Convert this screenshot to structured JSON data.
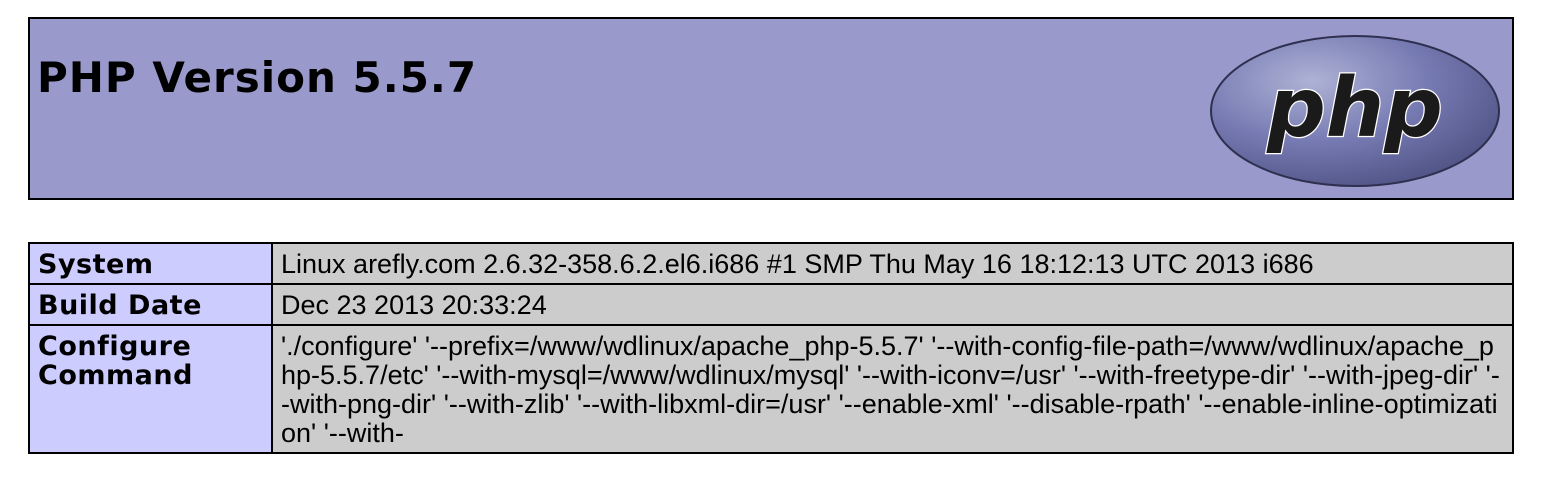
{
  "header": {
    "title": "PHP Version 5.5.7",
    "logo_text": "php",
    "logo_icon": "php-logo-icon"
  },
  "colors": {
    "header_bg": "#9999cc",
    "key_cell_bg": "#ccccff",
    "value_cell_bg": "#cccccc",
    "logo_fill": "#777bb3",
    "border": "#000000"
  },
  "info_table": {
    "rows": [
      {
        "key": "System",
        "value": "Linux arefly.com 2.6.32-358.6.2.el6.i686 #1 SMP Thu May 16 18:12:13 UTC 2013 i686"
      },
      {
        "key": "Build Date",
        "value": "Dec 23 2013 20:33:24"
      },
      {
        "key": "Configure Command",
        "value": "'./configure' '--prefix=/www/wdlinux/apache_php-5.5.7' '--with-config-file-path=/www/wdlinux/apache_php-5.5.7/etc' '--with-mysql=/www/wdlinux/mysql' '--with-iconv=/usr' '--with-freetype-dir' '--with-jpeg-dir' '--with-png-dir' '--with-zlib' '--with-libxml-dir=/usr' '--enable-xml' '--disable-rpath' '--enable-inline-optimization' '--with-"
      }
    ]
  }
}
